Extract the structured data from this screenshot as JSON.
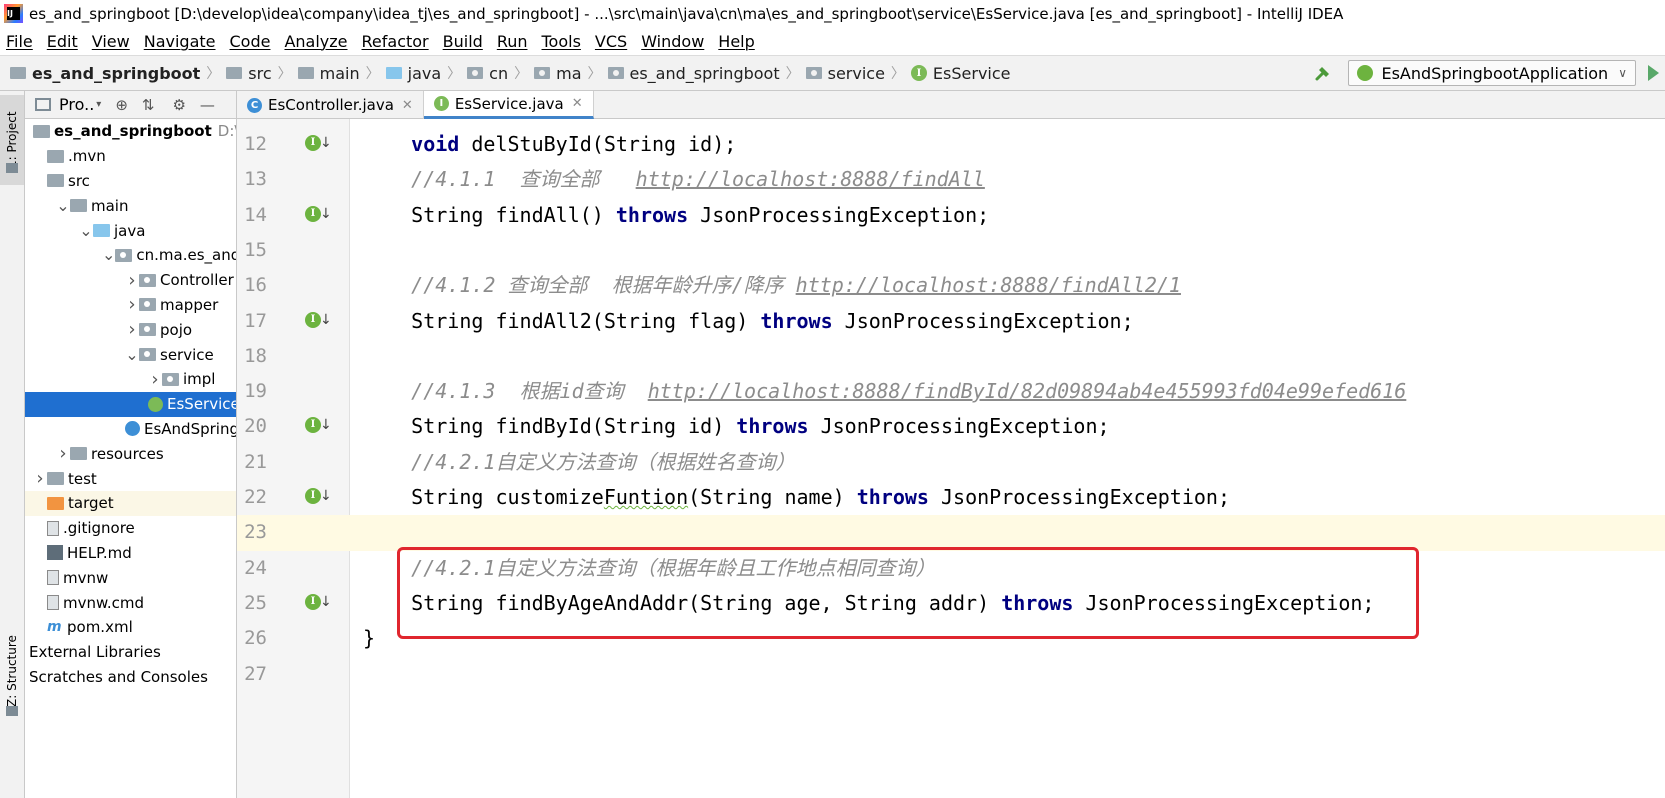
{
  "window": {
    "title": "es_and_springboot [D:\\develop\\idea\\company\\idea_tj\\es_and_springboot] - ...\\src\\main\\java\\cn\\ma\\es_and_springboot\\service\\EsService.java [es_and_springboot] - IntelliJ IDEA"
  },
  "menu": [
    "File",
    "Edit",
    "View",
    "Navigate",
    "Code",
    "Analyze",
    "Refactor",
    "Build",
    "Run",
    "Tools",
    "VCS",
    "Window",
    "Help"
  ],
  "breadcrumb": [
    "es_and_springboot",
    "src",
    "main",
    "java",
    "cn",
    "ma",
    "es_and_springboot",
    "service",
    "EsService"
  ],
  "run_config": {
    "label": "EsAndSpringbootApplication"
  },
  "left_strip": {
    "project_tab": "1: Project",
    "structure_tab": "Z: Structure"
  },
  "project_panel": {
    "title": "Pro..",
    "tree": [
      {
        "label": "es_and_springboot",
        "hint": "D:\\develo",
        "indent": 0,
        "arrow": "",
        "icon": "module",
        "bold": true
      },
      {
        "label": ".mvn",
        "indent": 0,
        "arrow": "",
        "icon": "folder"
      },
      {
        "label": "src",
        "indent": 0,
        "arrow": "",
        "icon": "folder"
      },
      {
        "label": "main",
        "indent": 1,
        "arrow": "▾",
        "icon": "folder"
      },
      {
        "label": "java",
        "indent": 2,
        "arrow": "▾",
        "icon": "folder-blue"
      },
      {
        "label": "cn.ma.es_and_sp",
        "indent": 3,
        "arrow": "▾",
        "icon": "package"
      },
      {
        "label": "Controller",
        "indent": 4,
        "arrow": "›",
        "icon": "package"
      },
      {
        "label": "mapper",
        "indent": 4,
        "arrow": "›",
        "icon": "package"
      },
      {
        "label": "pojo",
        "indent": 4,
        "arrow": "›",
        "icon": "package"
      },
      {
        "label": "service",
        "indent": 4,
        "arrow": "▾",
        "icon": "package"
      },
      {
        "label": "impl",
        "indent": 5,
        "arrow": "›",
        "icon": "package"
      },
      {
        "label": "EsService",
        "indent": 5,
        "arrow": "",
        "icon": "interface",
        "selected": true
      },
      {
        "label": "EsAndSpringl",
        "indent": 4,
        "arrow": "",
        "icon": "class"
      },
      {
        "label": "resources",
        "indent": 1,
        "arrow": "›",
        "icon": "folder"
      },
      {
        "label": "test",
        "indent": 0,
        "arrow": "›",
        "icon": "folder"
      },
      {
        "label": "target",
        "indent": 0,
        "arrow": "",
        "icon": "folder-orange",
        "excluded": true
      },
      {
        "label": ".gitignore",
        "indent": 0,
        "arrow": "",
        "icon": "file"
      },
      {
        "label": "HELP.md",
        "indent": 0,
        "arrow": "",
        "icon": "md"
      },
      {
        "label": "mvnw",
        "indent": 0,
        "arrow": "",
        "icon": "file"
      },
      {
        "label": "mvnw.cmd",
        "indent": 0,
        "arrow": "",
        "icon": "file"
      },
      {
        "label": "pom.xml",
        "indent": 0,
        "arrow": "",
        "icon": "maven"
      },
      {
        "label": "External Libraries",
        "indent": -1,
        "arrow": "",
        "icon": ""
      },
      {
        "label": "Scratches and Consoles",
        "indent": -1,
        "arrow": "",
        "icon": ""
      }
    ]
  },
  "editor_tabs": [
    {
      "label": "EsController.java",
      "kind": "class",
      "active": false
    },
    {
      "label": "EsService.java",
      "kind": "interface",
      "active": true
    }
  ],
  "editor": {
    "lines": [
      {
        "num": "12",
        "impl": true,
        "tokens": [
          [
            "",
            "    "
          ],
          [
            "kw",
            "void"
          ],
          [
            "",
            " delStuById(String id);"
          ]
        ]
      },
      {
        "num": "13",
        "impl": false,
        "tokens": [
          [
            "cm",
            "    //4.1.1  查询全部   "
          ],
          [
            "cm-link",
            "http://localhost:8888/findAll"
          ]
        ]
      },
      {
        "num": "14",
        "impl": true,
        "tokens": [
          [
            "",
            "    String findAll() "
          ],
          [
            "kw",
            "throws"
          ],
          [
            "",
            " JsonProcessingException;"
          ]
        ]
      },
      {
        "num": "15",
        "impl": false,
        "tokens": []
      },
      {
        "num": "16",
        "impl": false,
        "tokens": [
          [
            "cm",
            "    //4.1.2 查询全部  根据年龄升序/降序 "
          ],
          [
            "cm-link",
            "http://localhost:8888/findAll2/1"
          ]
        ]
      },
      {
        "num": "17",
        "impl": true,
        "tokens": [
          [
            "",
            "    String findAll2(String flag) "
          ],
          [
            "kw",
            "throws"
          ],
          [
            "",
            " JsonProcessingException;"
          ]
        ]
      },
      {
        "num": "18",
        "impl": false,
        "tokens": []
      },
      {
        "num": "19",
        "impl": false,
        "tokens": [
          [
            "cm",
            "    //4.1.3  根据id查询  "
          ],
          [
            "cm-link",
            "http://localhost:8888/findById/82d09894ab4e455993fd04e99efed616"
          ]
        ]
      },
      {
        "num": "20",
        "impl": true,
        "tokens": [
          [
            "",
            "    String findById(String id) "
          ],
          [
            "kw",
            "throws"
          ],
          [
            "",
            " JsonProcessingException;"
          ]
        ]
      },
      {
        "num": "21",
        "impl": false,
        "tokens": [
          [
            "cm",
            "    //4.2.1自定义方法查询（根据姓名查询）"
          ]
        ]
      },
      {
        "num": "22",
        "impl": true,
        "tokens": [
          [
            "",
            "    String customize"
          ],
          [
            "typo",
            "Funtion"
          ],
          [
            "",
            "(String name) "
          ],
          [
            "kw",
            "throws"
          ],
          [
            "",
            " JsonProcessingException;"
          ]
        ]
      },
      {
        "num": "23",
        "impl": false,
        "caret": true,
        "tokens": []
      },
      {
        "num": "24",
        "impl": false,
        "tokens": [
          [
            "cm",
            "    //4.2.1自定义方法查询（根据年龄且工作地点相同查询）"
          ]
        ]
      },
      {
        "num": "25",
        "impl": true,
        "tokens": [
          [
            "",
            "    String findByAgeAndAddr(String age, String addr) "
          ],
          [
            "kw",
            "throws"
          ],
          [
            "",
            " JsonProcessingException;"
          ]
        ]
      },
      {
        "num": "26",
        "impl": false,
        "tokens": [
          [
            "",
            "}"
          ]
        ]
      },
      {
        "num": "27",
        "impl": false,
        "tokens": []
      }
    ]
  },
  "colors": {
    "keyword": "#000080",
    "comment": "#8c8c8c",
    "selection": "#1f6fd0",
    "highlight_box": "#e0262e",
    "caret_line": "#fffae3"
  }
}
